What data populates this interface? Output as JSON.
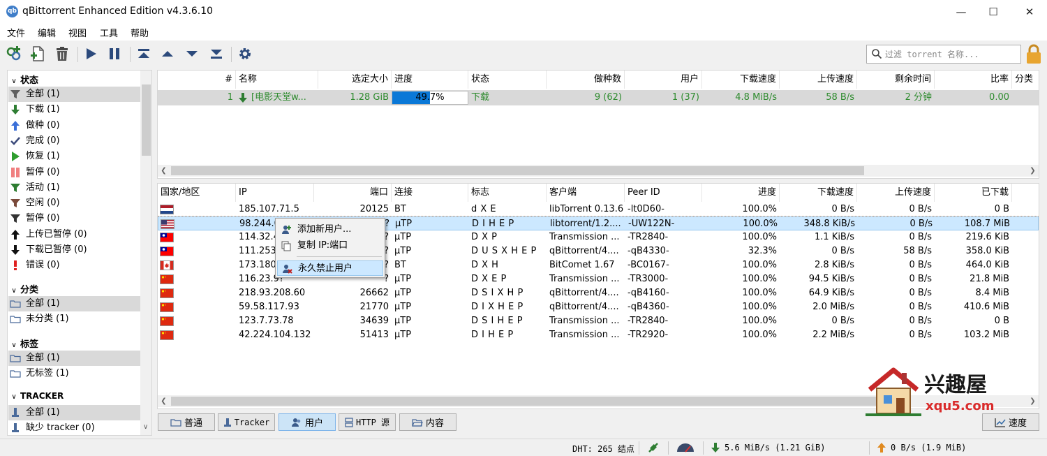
{
  "window": {
    "title": "qBittorrent Enhanced Edition v4.3.6.10",
    "app_icon": "qb"
  },
  "menu": [
    "文件",
    "编辑",
    "视图",
    "工具",
    "帮助"
  ],
  "search": {
    "placeholder": "过滤 torrent 名称..."
  },
  "sidebar": {
    "status_header": "状态",
    "status_items": [
      {
        "label": "全部 (1)",
        "icon": "filter-icon",
        "color": "#606060"
      },
      {
        "label": "下载 (1)",
        "icon": "download-arrow-icon",
        "color": "#2e7d32"
      },
      {
        "label": "做种 (0)",
        "icon": "upload-arrow-icon",
        "color": "#3a6fd8"
      },
      {
        "label": "完成 (0)",
        "icon": "check-icon",
        "color": "#3b4a7a"
      },
      {
        "label": "恢复 (1)",
        "icon": "play-icon",
        "color": "#2e9d2e"
      },
      {
        "label": "暂停 (0)",
        "icon": "pause-icon",
        "color": "#f08080"
      },
      {
        "label": "活动 (1)",
        "icon": "filter-icon",
        "color": "#2e7d32"
      },
      {
        "label": "空闲 (0)",
        "icon": "filter-icon",
        "color": "#7a4a3a"
      },
      {
        "label": "暂停 (0)",
        "icon": "filter-icon",
        "color": "#333333"
      },
      {
        "label": "上传已暂停 (0)",
        "icon": "upload-arrow-icon",
        "color": "#111111"
      },
      {
        "label": "下载已暂停 (0)",
        "icon": "download-arrow-icon",
        "color": "#111111"
      },
      {
        "label": "错误 (0)",
        "icon": "exclamation-icon",
        "color": "#e02020"
      }
    ],
    "category_header": "分类",
    "category_items": [
      "全部 (1)",
      "未分类 (1)"
    ],
    "tag_header": "标签",
    "tag_items": [
      "全部 (1)",
      "无标签 (1)"
    ],
    "tracker_header": "TRACKER",
    "tracker_items": [
      "全部 (1)",
      "缺少 tracker (0)"
    ]
  },
  "torrents": {
    "columns": [
      "#",
      "名称",
      "选定大小",
      "进度",
      "状态",
      "做种数",
      "用户",
      "下载速度",
      "上传速度",
      "剩余时间",
      "比率",
      "分类"
    ],
    "rows": [
      {
        "num": "1",
        "name": "[电影天堂w...",
        "size": "1.28 GiB",
        "progress_text": "49.7%",
        "progress": 0.497,
        "status": "下载",
        "seeds": "9 (62)",
        "peers": "1 (37)",
        "dl": "4.8 MiB/s",
        "ul": "58 B/s",
        "eta": "2 分钟",
        "ratio": "0.00"
      }
    ]
  },
  "peers": {
    "columns": [
      "国家/地区",
      "IP",
      "端口",
      "连接",
      "标志",
      "客户端",
      "Peer ID",
      "进度",
      "下载速度",
      "上传速度",
      "已下载"
    ],
    "rows": [
      {
        "flag": "nl",
        "ip": "185.107.71.5",
        "port": "20125",
        "conn": "BT",
        "flags": "d X E",
        "client": "libTorrent 0.13.6",
        "peerid": "-lt0D60-",
        "progress": "100.0%",
        "dl": "0 B/s",
        "ul": "0 B/s",
        "downloaded": "0 B"
      },
      {
        "flag": "us",
        "ip": "98.244.0.?",
        "port": "?",
        "conn": "μTP",
        "flags": "D I H E P",
        "client": "libtorrent/1.2....",
        "peerid": "-UW122N-",
        "progress": "100.0%",
        "dl": "348.8 KiB/s",
        "ul": "0 B/s",
        "downloaded": "108.7 MiB"
      },
      {
        "flag": "tw",
        "ip": "114.32.4?",
        "port": "?",
        "conn": "μTP",
        "flags": "D X P",
        "client": "Transmission ...",
        "peerid": "-TR2840-",
        "progress": "100.0%",
        "dl": "1.1 KiB/s",
        "ul": "0 B/s",
        "downloaded": "219.6 KiB"
      },
      {
        "flag": "tw",
        "ip": "111.253.?",
        "port": "?",
        "conn": "μTP",
        "flags": "D U S X H E P",
        "client": "qBittorrent/4....",
        "peerid": "-qB4330-",
        "progress": "32.3%",
        "dl": "0 B/s",
        "ul": "58 B/s",
        "downloaded": "358.0 KiB"
      },
      {
        "flag": "ca",
        "ip": "173.180.?",
        "port": "?",
        "conn": "BT",
        "flags": "D X H",
        "client": "BitComet 1.67",
        "peerid": "-BC0167-",
        "progress": "100.0%",
        "dl": "2.8 KiB/s",
        "ul": "0 B/s",
        "downloaded": "464.0 KiB"
      },
      {
        "flag": "cn",
        "ip": "116.23.9?",
        "port": "?",
        "conn": "μTP",
        "flags": "D X E P",
        "client": "Transmission ...",
        "peerid": "-TR3000-",
        "progress": "100.0%",
        "dl": "94.5 KiB/s",
        "ul": "0 B/s",
        "downloaded": "21.8 MiB"
      },
      {
        "flag": "cn",
        "ip": "218.93.208.60",
        "port": "26662",
        "conn": "μTP",
        "flags": "D S I X H P",
        "client": "qBittorrent/4....",
        "peerid": "-qB4160-",
        "progress": "100.0%",
        "dl": "64.9 KiB/s",
        "ul": "0 B/s",
        "downloaded": "8.4 MiB"
      },
      {
        "flag": "cn",
        "ip": "59.58.117.93",
        "port": "21770",
        "conn": "μTP",
        "flags": "D I X H E P",
        "client": "qBittorrent/4....",
        "peerid": "-qB4360-",
        "progress": "100.0%",
        "dl": "2.0 MiB/s",
        "ul": "0 B/s",
        "downloaded": "410.6 MiB"
      },
      {
        "flag": "cn",
        "ip": "123.7.73.78",
        "port": "34639",
        "conn": "μTP",
        "flags": "D S I H E P",
        "client": "Transmission ...",
        "peerid": "-TR2840-",
        "progress": "100.0%",
        "dl": "0 B/s",
        "ul": "0 B/s",
        "downloaded": "0 B"
      },
      {
        "flag": "cn",
        "ip": "42.224.104.132",
        "port": "51413",
        "conn": "μTP",
        "flags": "D I H E P",
        "client": "Transmission ...",
        "peerid": "-TR2920-",
        "progress": "100.0%",
        "dl": "2.2 MiB/s",
        "ul": "0 B/s",
        "downloaded": "103.2 MiB"
      }
    ]
  },
  "context_menu": [
    "添加新用户...",
    "复制 IP:端口",
    "永久禁止用户"
  ],
  "bottom_tabs": [
    "普通",
    "Tracker",
    "用户",
    "HTTP 源",
    "内容"
  ],
  "speed_button": "速度",
  "statusbar": {
    "dht": "DHT: 265 结点",
    "download": "5.6 MiB/s (1.21 GiB)",
    "upload": "0 B/s (1.9 MiB)"
  },
  "watermark": {
    "name": "兴趣屋",
    "url": "xqu5.com"
  },
  "colors": {
    "accent": "#0078d7",
    "downloading_text": "#2e8b2e",
    "selected_row": "#cce8ff",
    "progress_fill": "#0a78d7"
  }
}
